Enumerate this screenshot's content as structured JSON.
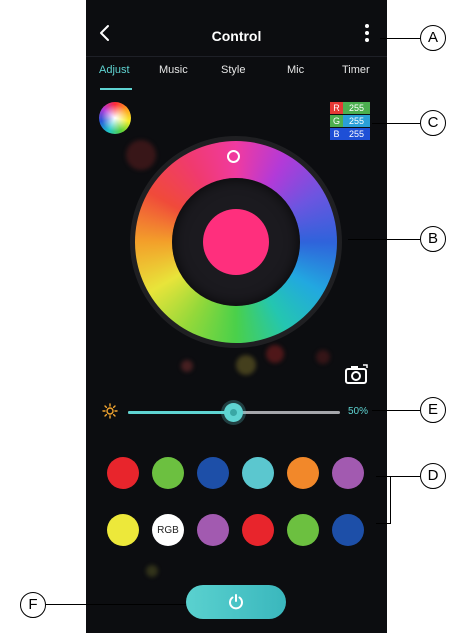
{
  "header": {
    "title": "Control"
  },
  "tabs": [
    {
      "label": "Adjust",
      "active": true
    },
    {
      "label": "Music",
      "active": false
    },
    {
      "label": "Style",
      "active": false
    },
    {
      "label": "Mic",
      "active": false
    },
    {
      "label": "Timer",
      "active": false
    }
  ],
  "rgb": {
    "r_label": "R",
    "r_value": "255",
    "g_label": "G",
    "g_value": "255",
    "b_label": "B",
    "b_value": "255",
    "r_color": "#e53935",
    "g_color": "#4caf50",
    "b_color": "#1e4fd6"
  },
  "current_color": "#ff2f7d",
  "brightness": {
    "percent": 50,
    "label": "50%"
  },
  "presets_row1": [
    "#e8252c",
    "#6cc040",
    "#1d4fa8",
    "#5bc7cf",
    "#f2882a",
    "#a25ab0"
  ],
  "presets_row2": [
    {
      "color": "#ede83a",
      "label": ""
    },
    {
      "color": "#ffffff",
      "label": "RGB"
    },
    {
      "color": "#a25ab0",
      "label": ""
    },
    {
      "color": "#e8252c",
      "label": ""
    },
    {
      "color": "#6cc040",
      "label": ""
    },
    {
      "color": "#1d4fa8",
      "label": ""
    }
  ],
  "callouts": {
    "a": "A",
    "b": "B",
    "c": "C",
    "d": "D",
    "e": "E",
    "f": "F"
  },
  "accent": "#5fd4d2"
}
